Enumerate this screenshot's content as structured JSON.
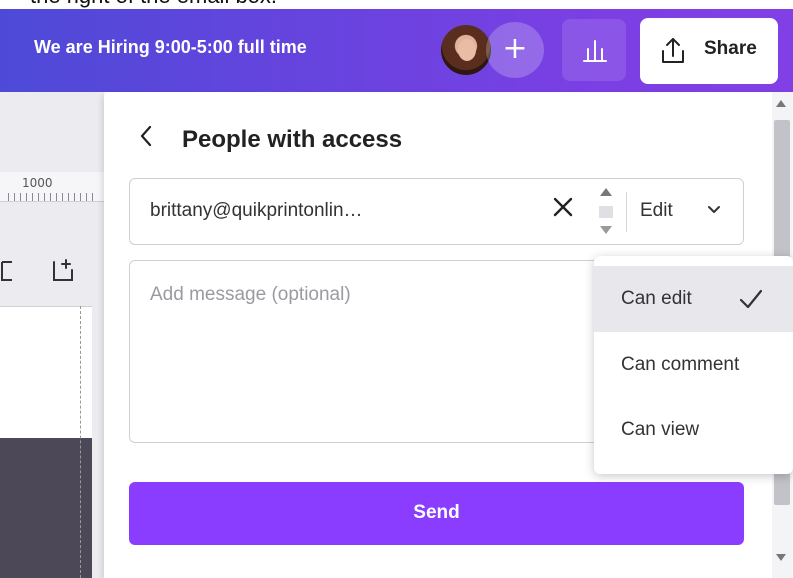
{
  "caption": {
    "text": "the right of the email box."
  },
  "header": {
    "hiring_text": "We are Hiring 9:00-5:00 full time",
    "add_collaborator_symbol": "+",
    "share_label": "Share",
    "gradient_colors": [
      "#4e4ad7",
      "#8140e6"
    ]
  },
  "canvas": {
    "ruler_number": "1000"
  },
  "panel": {
    "title": "People with access",
    "back_icon": "chevron-left-icon",
    "email_value": "brittany@quikprintonlin…",
    "clear_icon": "close-icon",
    "permission_value": "Edit",
    "message_placeholder": "Add message (optional)",
    "send_label": "Send",
    "send_color": "#8b3dff"
  },
  "permission_menu": {
    "items": [
      {
        "label": "Can edit",
        "selected": true
      },
      {
        "label": "Can comment",
        "selected": false
      },
      {
        "label": "Can view",
        "selected": false
      }
    ]
  }
}
